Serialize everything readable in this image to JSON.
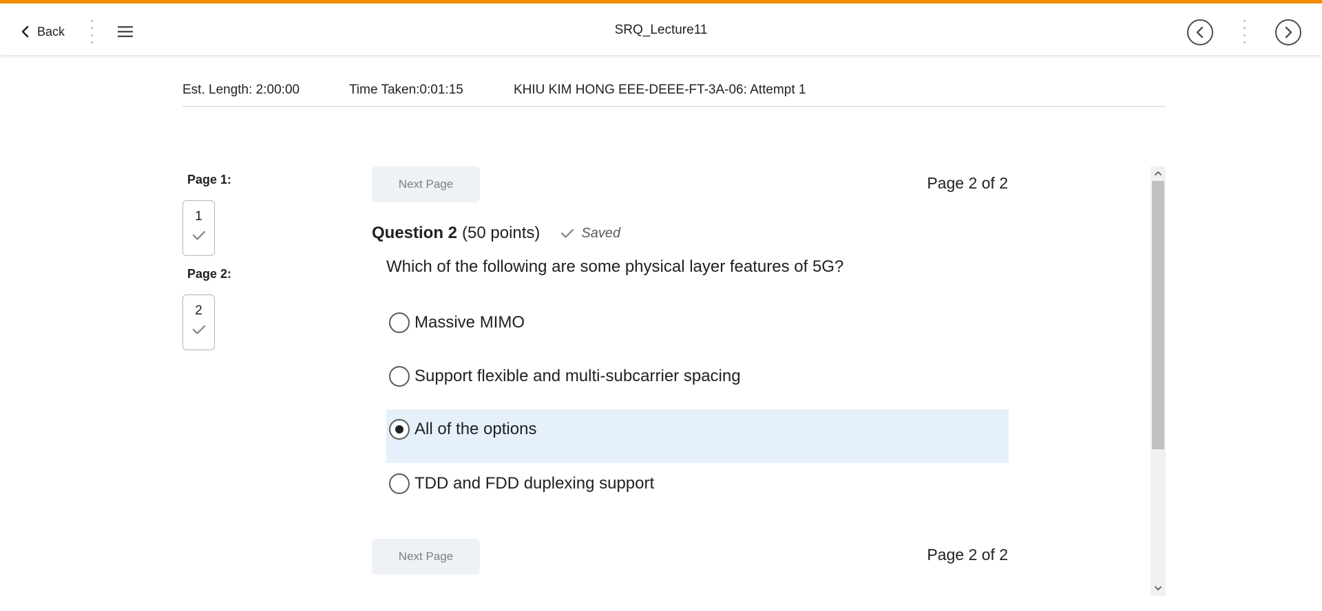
{
  "header": {
    "back_label": "Back",
    "title": "SRQ_Lecture11",
    "accent_color": "#f08c00"
  },
  "info": {
    "est_length": "Est. Length: 2:00:00",
    "time_taken": "Time Taken:0:01:15",
    "attempt": "KHIU KIM HONG EEE-DEEE-FT-3A-06: Attempt 1"
  },
  "sidebar": {
    "pages": [
      {
        "label": "Page 1:",
        "question_number": "1",
        "answered": true
      },
      {
        "label": "Page 2:",
        "question_number": "2",
        "answered": true
      }
    ]
  },
  "nav": {
    "next_page_label": "Next Page",
    "page_indicator": "Page 2 of 2"
  },
  "question": {
    "title": "Question 2",
    "points": "(50 points)",
    "status": "Saved",
    "text": "Which of the following are some physical layer features of 5G?",
    "options": [
      {
        "label": "Massive MIMO",
        "selected": false
      },
      {
        "label": "Support flexible and multi-subcarrier spacing",
        "selected": false
      },
      {
        "label": "All of the options",
        "selected": true
      },
      {
        "label": "TDD and FDD duplexing support",
        "selected": false
      }
    ]
  },
  "icons": {
    "back": "chevron-left-icon",
    "menu": "hamburger-menu-icon",
    "prev": "circle-chevron-left-icon",
    "next": "circle-chevron-right-icon",
    "checkmark": "checkmark-icon"
  }
}
